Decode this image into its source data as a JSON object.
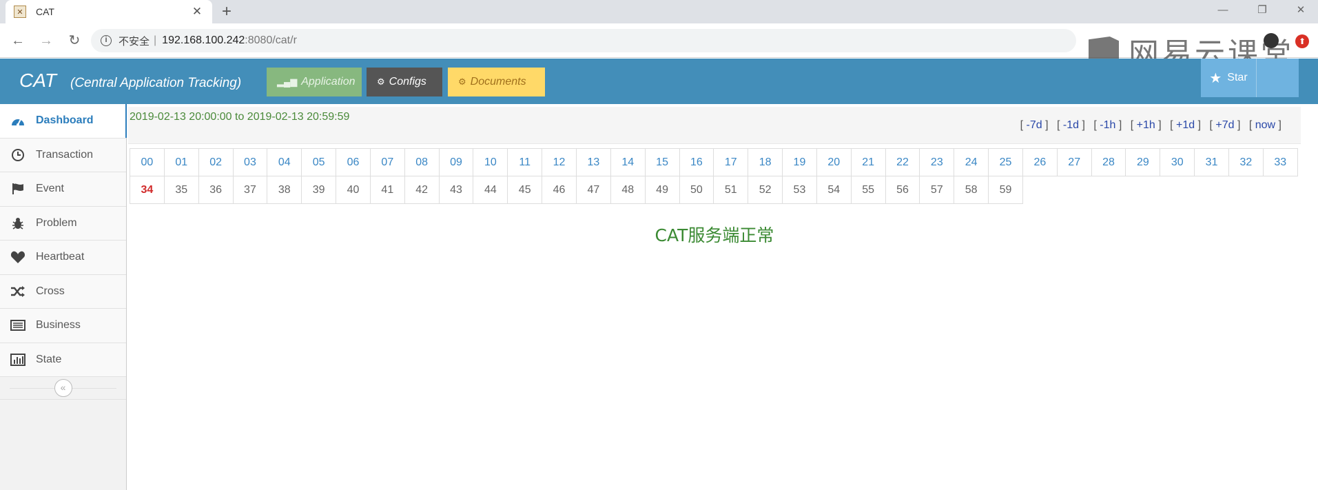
{
  "browser": {
    "tab_title": "CAT",
    "new_tab_icon": "plus-icon",
    "address": {
      "security_label": "不安全",
      "separator": "|",
      "host": "192.168.100.242",
      "path": ":8080/cat/r"
    },
    "watermark_text": "网易云课堂"
  },
  "header": {
    "brand": "CAT",
    "subtitle": "(Central Application Tracking)",
    "buttons": {
      "application": "Application",
      "configs": "Configs",
      "documents": "Documents"
    },
    "star_label": "Star",
    "colors": {
      "bar": "#438eb9",
      "application": "#87b87f",
      "configs": "#555555",
      "documents": "#ffd968"
    }
  },
  "sidebar": {
    "items": [
      {
        "label": "Dashboard",
        "icon": "dashboard-icon"
      },
      {
        "label": "Transaction",
        "icon": "clock-icon"
      },
      {
        "label": "Event",
        "icon": "flag-icon"
      },
      {
        "label": "Problem",
        "icon": "bug-icon"
      },
      {
        "label": "Heartbeat",
        "icon": "heart-icon"
      },
      {
        "label": "Cross",
        "icon": "shuffle-icon"
      },
      {
        "label": "Business",
        "icon": "list-icon"
      },
      {
        "label": "State",
        "icon": "bar-chart-icon"
      }
    ],
    "collapse_icon": "double-chevron-left-icon"
  },
  "range": {
    "text": "2019-02-13 20:00:00 to 2019-02-13 20:59:59",
    "links": [
      "-7d",
      "-1d",
      "-1h",
      "+1h",
      "+1d",
      "+7d",
      "now"
    ]
  },
  "minutes": {
    "labels": [
      "00",
      "01",
      "02",
      "03",
      "04",
      "05",
      "06",
      "07",
      "08",
      "09",
      "10",
      "11",
      "12",
      "13",
      "14",
      "15",
      "16",
      "17",
      "18",
      "19",
      "20",
      "21",
      "22",
      "23",
      "24",
      "25",
      "26",
      "27",
      "28",
      "29",
      "30",
      "31",
      "32",
      "33",
      "34",
      "35",
      "36",
      "37",
      "38",
      "39",
      "40",
      "41",
      "42",
      "43",
      "44",
      "45",
      "46",
      "47",
      "48",
      "49",
      "50",
      "51",
      "52",
      "53",
      "54",
      "55",
      "56",
      "57",
      "58",
      "59"
    ],
    "current": "34"
  },
  "status_message": "CAT服务端正常"
}
